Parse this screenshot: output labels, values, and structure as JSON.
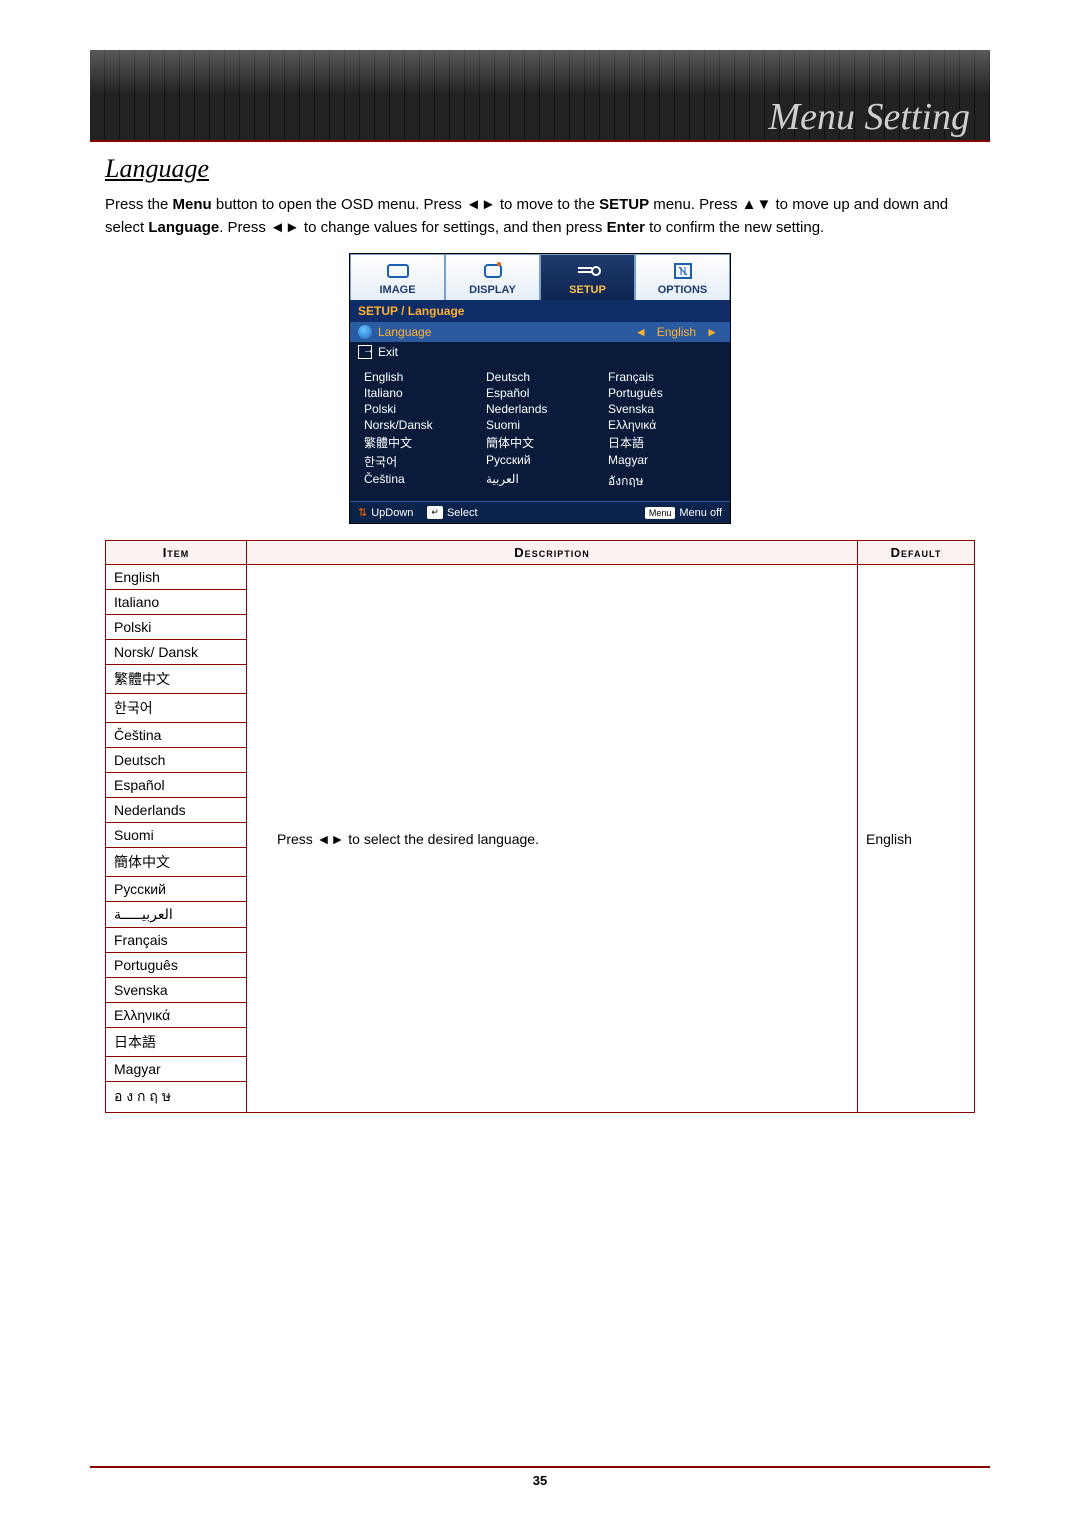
{
  "header": {
    "title": "Menu Setting"
  },
  "section": {
    "title": "Language"
  },
  "intro": {
    "part1": "Press the ",
    "bold1": "Menu",
    "part2": " button to open the OSD menu. Press ◄► to move to the ",
    "bold2": "SETUP",
    "part3": " menu. Press ▲▼ to move up and down and select ",
    "bold3": "Language",
    "part4": ". Press ◄► to change values for settings, and then press ",
    "bold4": "Enter",
    "part5": " to confirm the new setting."
  },
  "osd": {
    "tabs": [
      "IMAGE",
      "DISPLAY",
      "SETUP",
      "OPTIONS"
    ],
    "active_tab_index": 2,
    "breadcrumb": "SETUP / Language",
    "language_label": "Language",
    "language_value": "English",
    "exit_label": "Exit",
    "grid": [
      [
        "English",
        "Deutsch",
        "Français"
      ],
      [
        "Italiano",
        "Español",
        "Português"
      ],
      [
        "Polski",
        "Nederlands",
        "Svenska"
      ],
      [
        "Norsk/Dansk",
        "Suomi",
        "Ελληνικά"
      ],
      [
        "繁體中文",
        "簡体中文",
        "日本語"
      ],
      [
        "한국어",
        "Русский",
        "Magyar"
      ],
      [
        "Čeština",
        "العربية",
        "อังกฤษ"
      ]
    ],
    "footer": {
      "updown": "UpDown",
      "select": "Select",
      "menu_key": "Menu",
      "menuoff": "Menu off"
    }
  },
  "table": {
    "headers": {
      "item": "Item",
      "description": "Description",
      "default": "Default"
    },
    "items": [
      "English",
      "Italiano",
      "Polski",
      "Norsk/ Dansk",
      "繁體中文",
      "한국어",
      "Čeština",
      "Deutsch",
      "Español",
      "Nederlands",
      "Suomi",
      "簡体中文",
      "Русский",
      "العربيـــــة",
      "Français",
      "Português",
      "Svenska",
      "Ελληνικά",
      "日本語",
      "Magyar",
      "อ ง ก ฤ ษ"
    ],
    "description": "Press ◄► to select the desired language.",
    "default": "English"
  },
  "page_number": "35"
}
